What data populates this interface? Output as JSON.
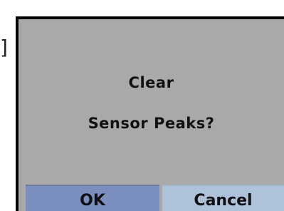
{
  "background": {
    "partial_glyph": "]"
  },
  "dialog": {
    "message_line1": "Clear",
    "message_line2": "Sensor Peaks?",
    "ok_label": "OK",
    "cancel_label": "Cancel"
  },
  "colors": {
    "dialog_bg": "#a9a9a9",
    "ok_button_bg": "#7a8fbe",
    "cancel_button_bg": "#aec3da",
    "border": "#000000"
  }
}
